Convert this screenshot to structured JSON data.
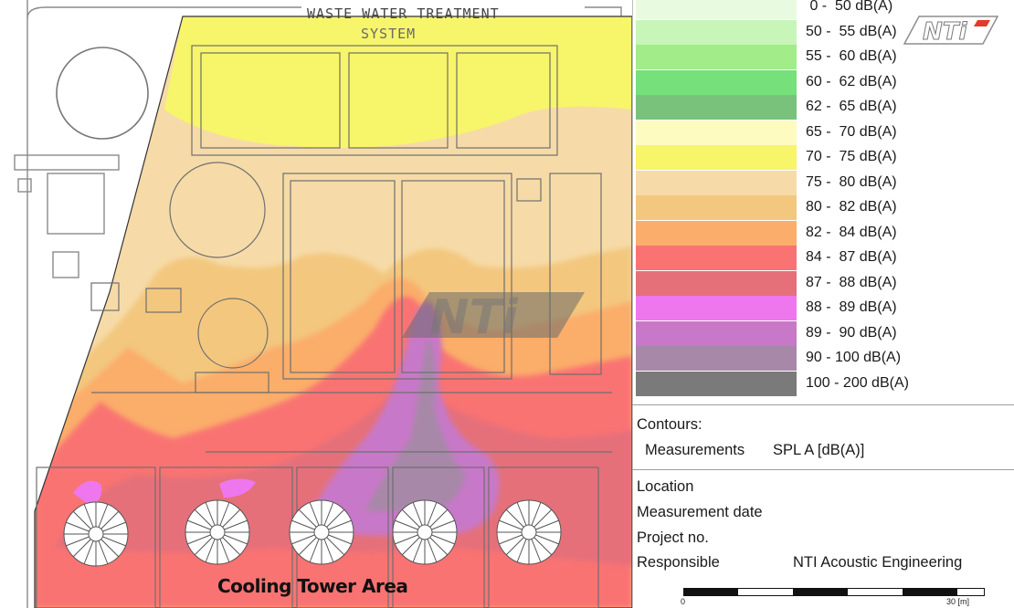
{
  "map": {
    "title_line1": "WASTE WATER TREATMENT",
    "title_line2": "SYSTEM",
    "area_label": "Cooling Tower Area",
    "watermark": "NTi"
  },
  "legend": {
    "levels": [
      {
        "label": " 0 -  50 dB(A)",
        "color": "#e8fbe0"
      },
      {
        "label": "50 -  55 dB(A)",
        "color": "#c8f5b8"
      },
      {
        "label": "55 -  60 dB(A)",
        "color": "#a2ec8a"
      },
      {
        "label": "60 -  62 dB(A)",
        "color": "#76e07a"
      },
      {
        "label": "62 -  65 dB(A)",
        "color": "#78c27c"
      },
      {
        "label": "65 -  70 dB(A)",
        "color": "#fdfbc0"
      },
      {
        "label": "70 -  75 dB(A)",
        "color": "#f7f56a"
      },
      {
        "label": "75 -  80 dB(A)",
        "color": "#f6dba8"
      },
      {
        "label": "80 -  82 dB(A)",
        "color": "#f3c77e"
      },
      {
        "label": "82 -  84 dB(A)",
        "color": "#fbad6b"
      },
      {
        "label": "84 -  87 dB(A)",
        "color": "#f97372"
      },
      {
        "label": "87 -  88 dB(A)",
        "color": "#e5707a"
      },
      {
        "label": "88 -  89 dB(A)",
        "color": "#ee77ee"
      },
      {
        "label": "89 -  90 dB(A)",
        "color": "#c878c8"
      },
      {
        "label": "90 - 100 dB(A)",
        "color": "#a788a8"
      },
      {
        "label": "100 - 200 dB(A)",
        "color": "#7a7a7a"
      }
    ]
  },
  "contours": {
    "heading": "Contours:",
    "measurements_label": "Measurements",
    "measurements_value": "SPL A [dB(A)]"
  },
  "info": {
    "location_label": "Location",
    "date_label": "Measurement date",
    "project_label": "Project no.",
    "responsible_label": "Responsible",
    "responsible_value": "NTI Acoustic Engineering"
  },
  "scale": {
    "start_label": "0",
    "end_label": "30 [m]"
  },
  "brand": {
    "logo_text": "NTi",
    "logo_accent": "#e23a2a"
  }
}
